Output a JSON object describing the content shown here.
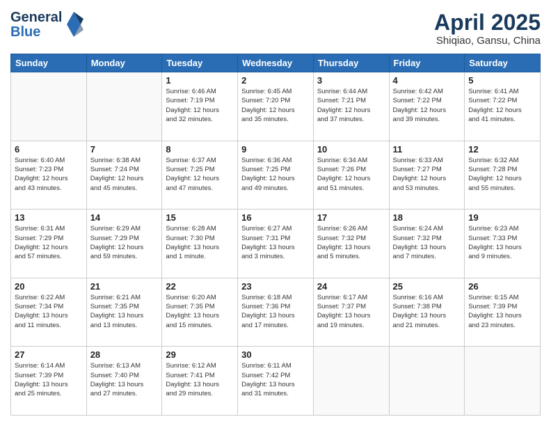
{
  "header": {
    "logo_general": "General",
    "logo_blue": "Blue",
    "title": "April 2025",
    "subtitle": "Shiqiao, Gansu, China"
  },
  "calendar": {
    "days_of_week": [
      "Sunday",
      "Monday",
      "Tuesday",
      "Wednesday",
      "Thursday",
      "Friday",
      "Saturday"
    ],
    "weeks": [
      [
        {
          "day": "",
          "info": ""
        },
        {
          "day": "",
          "info": ""
        },
        {
          "day": "1",
          "info": "Sunrise: 6:46 AM\nSunset: 7:19 PM\nDaylight: 12 hours\nand 32 minutes."
        },
        {
          "day": "2",
          "info": "Sunrise: 6:45 AM\nSunset: 7:20 PM\nDaylight: 12 hours\nand 35 minutes."
        },
        {
          "day": "3",
          "info": "Sunrise: 6:44 AM\nSunset: 7:21 PM\nDaylight: 12 hours\nand 37 minutes."
        },
        {
          "day": "4",
          "info": "Sunrise: 6:42 AM\nSunset: 7:22 PM\nDaylight: 12 hours\nand 39 minutes."
        },
        {
          "day": "5",
          "info": "Sunrise: 6:41 AM\nSunset: 7:22 PM\nDaylight: 12 hours\nand 41 minutes."
        }
      ],
      [
        {
          "day": "6",
          "info": "Sunrise: 6:40 AM\nSunset: 7:23 PM\nDaylight: 12 hours\nand 43 minutes."
        },
        {
          "day": "7",
          "info": "Sunrise: 6:38 AM\nSunset: 7:24 PM\nDaylight: 12 hours\nand 45 minutes."
        },
        {
          "day": "8",
          "info": "Sunrise: 6:37 AM\nSunset: 7:25 PM\nDaylight: 12 hours\nand 47 minutes."
        },
        {
          "day": "9",
          "info": "Sunrise: 6:36 AM\nSunset: 7:25 PM\nDaylight: 12 hours\nand 49 minutes."
        },
        {
          "day": "10",
          "info": "Sunrise: 6:34 AM\nSunset: 7:26 PM\nDaylight: 12 hours\nand 51 minutes."
        },
        {
          "day": "11",
          "info": "Sunrise: 6:33 AM\nSunset: 7:27 PM\nDaylight: 12 hours\nand 53 minutes."
        },
        {
          "day": "12",
          "info": "Sunrise: 6:32 AM\nSunset: 7:28 PM\nDaylight: 12 hours\nand 55 minutes."
        }
      ],
      [
        {
          "day": "13",
          "info": "Sunrise: 6:31 AM\nSunset: 7:29 PM\nDaylight: 12 hours\nand 57 minutes."
        },
        {
          "day": "14",
          "info": "Sunrise: 6:29 AM\nSunset: 7:29 PM\nDaylight: 12 hours\nand 59 minutes."
        },
        {
          "day": "15",
          "info": "Sunrise: 6:28 AM\nSunset: 7:30 PM\nDaylight: 13 hours\nand 1 minute."
        },
        {
          "day": "16",
          "info": "Sunrise: 6:27 AM\nSunset: 7:31 PM\nDaylight: 13 hours\nand 3 minutes."
        },
        {
          "day": "17",
          "info": "Sunrise: 6:26 AM\nSunset: 7:32 PM\nDaylight: 13 hours\nand 5 minutes."
        },
        {
          "day": "18",
          "info": "Sunrise: 6:24 AM\nSunset: 7:32 PM\nDaylight: 13 hours\nand 7 minutes."
        },
        {
          "day": "19",
          "info": "Sunrise: 6:23 AM\nSunset: 7:33 PM\nDaylight: 13 hours\nand 9 minutes."
        }
      ],
      [
        {
          "day": "20",
          "info": "Sunrise: 6:22 AM\nSunset: 7:34 PM\nDaylight: 13 hours\nand 11 minutes."
        },
        {
          "day": "21",
          "info": "Sunrise: 6:21 AM\nSunset: 7:35 PM\nDaylight: 13 hours\nand 13 minutes."
        },
        {
          "day": "22",
          "info": "Sunrise: 6:20 AM\nSunset: 7:35 PM\nDaylight: 13 hours\nand 15 minutes."
        },
        {
          "day": "23",
          "info": "Sunrise: 6:18 AM\nSunset: 7:36 PM\nDaylight: 13 hours\nand 17 minutes."
        },
        {
          "day": "24",
          "info": "Sunrise: 6:17 AM\nSunset: 7:37 PM\nDaylight: 13 hours\nand 19 minutes."
        },
        {
          "day": "25",
          "info": "Sunrise: 6:16 AM\nSunset: 7:38 PM\nDaylight: 13 hours\nand 21 minutes."
        },
        {
          "day": "26",
          "info": "Sunrise: 6:15 AM\nSunset: 7:39 PM\nDaylight: 13 hours\nand 23 minutes."
        }
      ],
      [
        {
          "day": "27",
          "info": "Sunrise: 6:14 AM\nSunset: 7:39 PM\nDaylight: 13 hours\nand 25 minutes."
        },
        {
          "day": "28",
          "info": "Sunrise: 6:13 AM\nSunset: 7:40 PM\nDaylight: 13 hours\nand 27 minutes."
        },
        {
          "day": "29",
          "info": "Sunrise: 6:12 AM\nSunset: 7:41 PM\nDaylight: 13 hours\nand 29 minutes."
        },
        {
          "day": "30",
          "info": "Sunrise: 6:11 AM\nSunset: 7:42 PM\nDaylight: 13 hours\nand 31 minutes."
        },
        {
          "day": "",
          "info": ""
        },
        {
          "day": "",
          "info": ""
        },
        {
          "day": "",
          "info": ""
        }
      ]
    ]
  }
}
